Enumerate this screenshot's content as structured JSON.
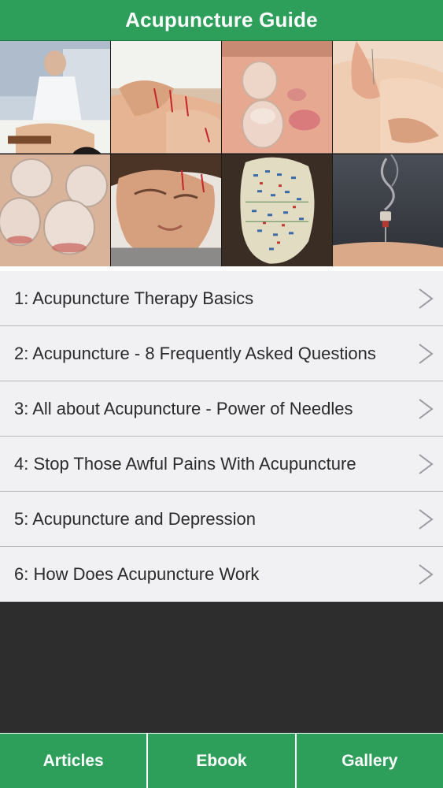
{
  "app": {
    "title": "Acupuncture Guide"
  },
  "colors": {
    "accent_green": "#2e9e5b",
    "list_background": "#f1f1f4",
    "dark_background": "#2d2d2d",
    "text": "#2a2a2a"
  },
  "gallery": {
    "photos": [
      {
        "subject": "practitioner treating patient on massage table"
      },
      {
        "subject": "needles inserted in hand"
      },
      {
        "subject": "glass cupping on back"
      },
      {
        "subject": "hands inserting needle"
      },
      {
        "subject": "glass cups"
      },
      {
        "subject": "needles in face of man"
      },
      {
        "subject": "acupuncture points head model"
      },
      {
        "subject": "moxibustion needle with smoke"
      }
    ]
  },
  "articles": {
    "items": [
      {
        "label": "1: Acupuncture Therapy Basics"
      },
      {
        "label": "2: Acupuncture - 8 Frequently Asked Questions"
      },
      {
        "label": "3: All about Acupuncture - Power of Needles"
      },
      {
        "label": "4: Stop Those Awful Pains With Acupuncture"
      },
      {
        "label": "5: Acupuncture and Depression"
      },
      {
        "label": "6: How Does Acupuncture Work"
      }
    ],
    "chevron_icon": "chevron-right-icon"
  },
  "tabs": [
    {
      "label": "Articles"
    },
    {
      "label": "Ebook"
    },
    {
      "label": "Gallery"
    }
  ]
}
